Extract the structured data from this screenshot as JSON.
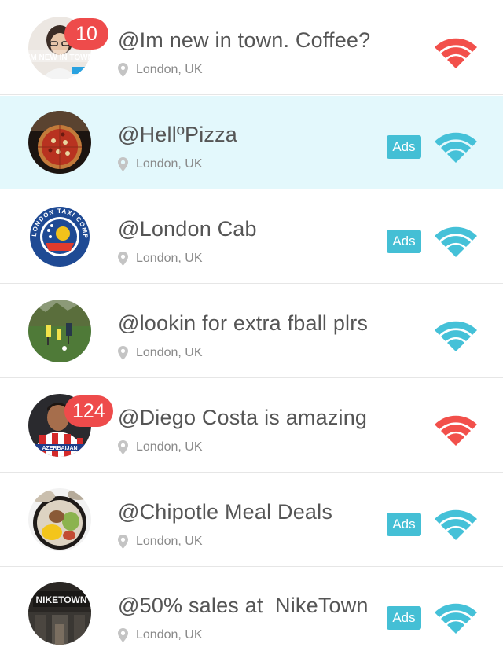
{
  "colors": {
    "hot": "#f2504b",
    "normal": "#45c1d8",
    "ads": "#44bfd5",
    "badge": "#ee4b4b",
    "highlight": "#e3f8fc"
  },
  "items": [
    {
      "title": "@Im new in town. Coffee?",
      "location": "London, UK",
      "badge": "10",
      "ads": "",
      "signal": "red-wifi-icon",
      "avatar_text": "I'M NEW IN TOWN"
    },
    {
      "title": "@HellºPizza",
      "location": "London, UK",
      "badge": "",
      "ads": "Ads",
      "signal": "blue-wifi-icon"
    },
    {
      "title": "@London Cab",
      "location": "London, UK",
      "badge": "",
      "ads": "Ads",
      "signal": "blue-wifi-icon",
      "avatar_text": "THE LONDON TAXI COMPANY"
    },
    {
      "title": "@lookin for extra fball plrs",
      "location": "London, UK",
      "badge": "",
      "ads": "",
      "signal": "blue-wifi-icon"
    },
    {
      "title": "@Diego Costa is amazing",
      "location": "London, UK",
      "badge": "124",
      "ads": "",
      "signal": "red-wifi-icon",
      "avatar_text": "AZERBAIJAN"
    },
    {
      "title": "@Chipotle Meal Deals",
      "location": "London, UK",
      "badge": "",
      "ads": "Ads",
      "signal": "blue-wifi-icon"
    },
    {
      "title": "@50% sales at  NikeTown",
      "location": "London, UK",
      "badge": "",
      "ads": "Ads",
      "signal": "blue-wifi-icon",
      "avatar_text": "NIKETOWN"
    }
  ]
}
